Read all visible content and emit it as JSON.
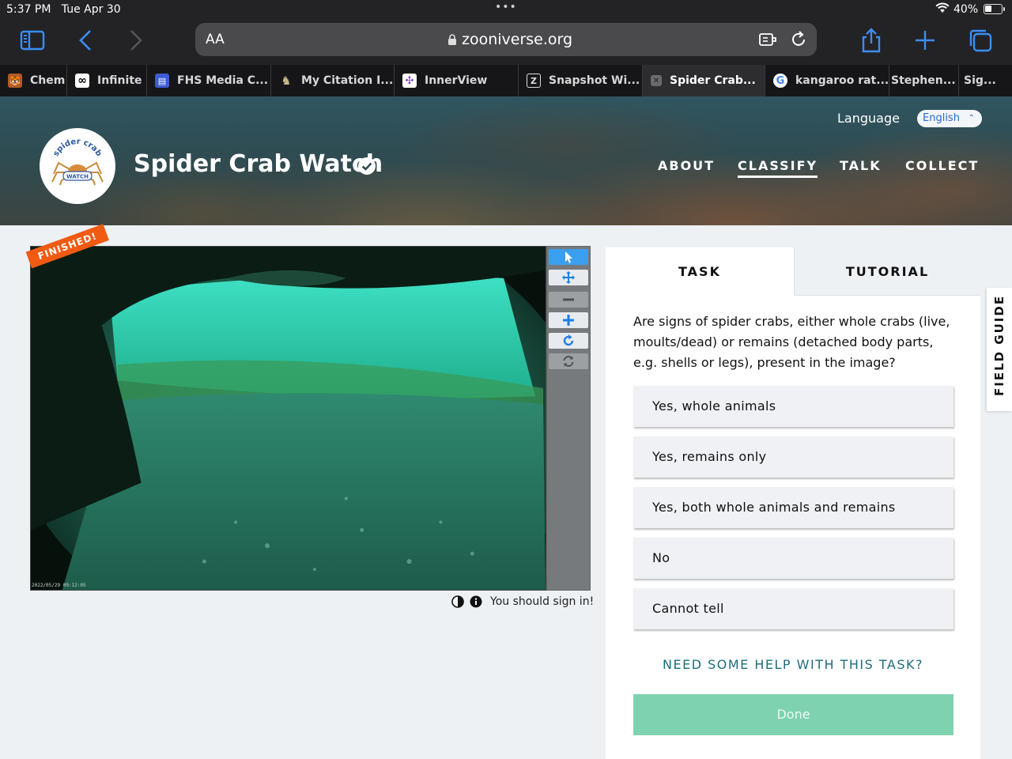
{
  "status_bar": {
    "time": "5:37 PM",
    "date": "Tue Apr 30",
    "battery": "40%"
  },
  "browser": {
    "text_size_label": "AA",
    "url": "zooniverse.org",
    "accent": "#3a8ef6",
    "tabs": [
      {
        "label": "Chem",
        "icon": "tiger-favicon",
        "color": "#b05a2a"
      },
      {
        "label": "Infinite C",
        "icon": "infinity-favicon",
        "color": "#ffffff"
      },
      {
        "label": "FHS Media C...",
        "icon": "fhs-favicon",
        "color": "#3d5bd8"
      },
      {
        "label": "My Citation I...",
        "icon": "citation-favicon",
        "color": "#8b7a5a"
      },
      {
        "label": "InnerView",
        "icon": "innerview-favicon",
        "color": "#7b3fcf"
      },
      {
        "label": "Snapshot Wi...",
        "icon": "zooniverse-favicon",
        "color": "#444444"
      },
      {
        "label": "Spider Crab...",
        "icon": "close-tab-icon",
        "color": "#666666"
      },
      {
        "label": "kangaroo rat...",
        "icon": "google-favicon",
        "color": "#ffffff"
      },
      {
        "label": "Stephen...",
        "icon": "",
        "color": ""
      },
      {
        "label": "Sig...",
        "icon": "",
        "color": ""
      }
    ]
  },
  "site": {
    "title": "Spider Crab Watch",
    "logo_text_top": "spider crab",
    "logo_text_bottom": "WATCH",
    "language_label": "Language",
    "language_value": "English",
    "nav": [
      {
        "label": "ABOUT",
        "active": false
      },
      {
        "label": "CLASSIFY",
        "active": true
      },
      {
        "label": "TALK",
        "active": false
      },
      {
        "label": "COLLECT",
        "active": false
      }
    ]
  },
  "viewer": {
    "banner": "FINISHED!",
    "timestamp": "2022/05/29 09:12:05",
    "sign_in_text": "You should sign in!",
    "tools": [
      "pointer",
      "pan",
      "zoom-out",
      "zoom-in",
      "rotate",
      "reset"
    ]
  },
  "task": {
    "tabs": [
      "TASK",
      "TUTORIAL"
    ],
    "question": "Are signs of spider crabs, either whole crabs (live, moults/dead) or remains (detached body parts, e.g. shells or legs), present in the image?",
    "answers": [
      "Yes, whole animals",
      "Yes, remains only",
      "Yes, both whole animals and remains",
      "No",
      "Cannot tell"
    ],
    "help_link": "NEED SOME HELP WITH THIS TASK?",
    "done_label": "Done",
    "done_color": "#7fd2b0"
  },
  "field_guide_label": "FIELD GUIDE"
}
